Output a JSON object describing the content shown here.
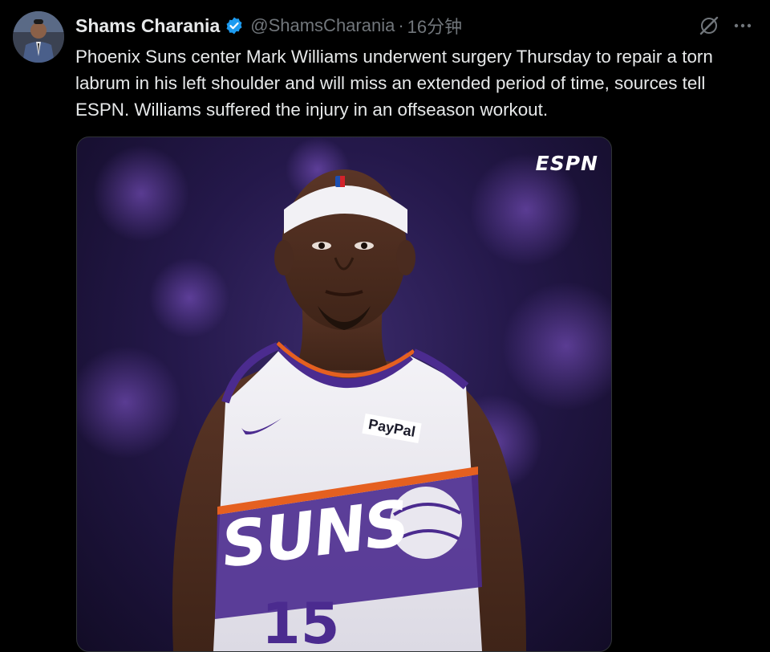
{
  "tweet": {
    "author_name": "Shams Charania",
    "handle": "@ShamsCharania",
    "separator": "·",
    "time": "16分钟",
    "text": "Phoenix Suns center Mark Williams underwent surgery Thursday to repair a torn labrum in his left shoulder and will miss an extended period of time, sources tell ESPN. Williams suffered the injury in an offseason workout."
  },
  "media": {
    "logo_text": "ESPN",
    "sponsor_text": "PayPal",
    "jersey_text": "SUNS",
    "jersey_number": "15"
  },
  "icons": {
    "verified": "verified-badge-icon",
    "grok": "grok-icon",
    "more": "more-icon"
  },
  "colors": {
    "verified_blue": "#1d9bf0",
    "suns_purple": "#4b2b8f",
    "suns_orange": "#e56020",
    "background": "#000000"
  }
}
